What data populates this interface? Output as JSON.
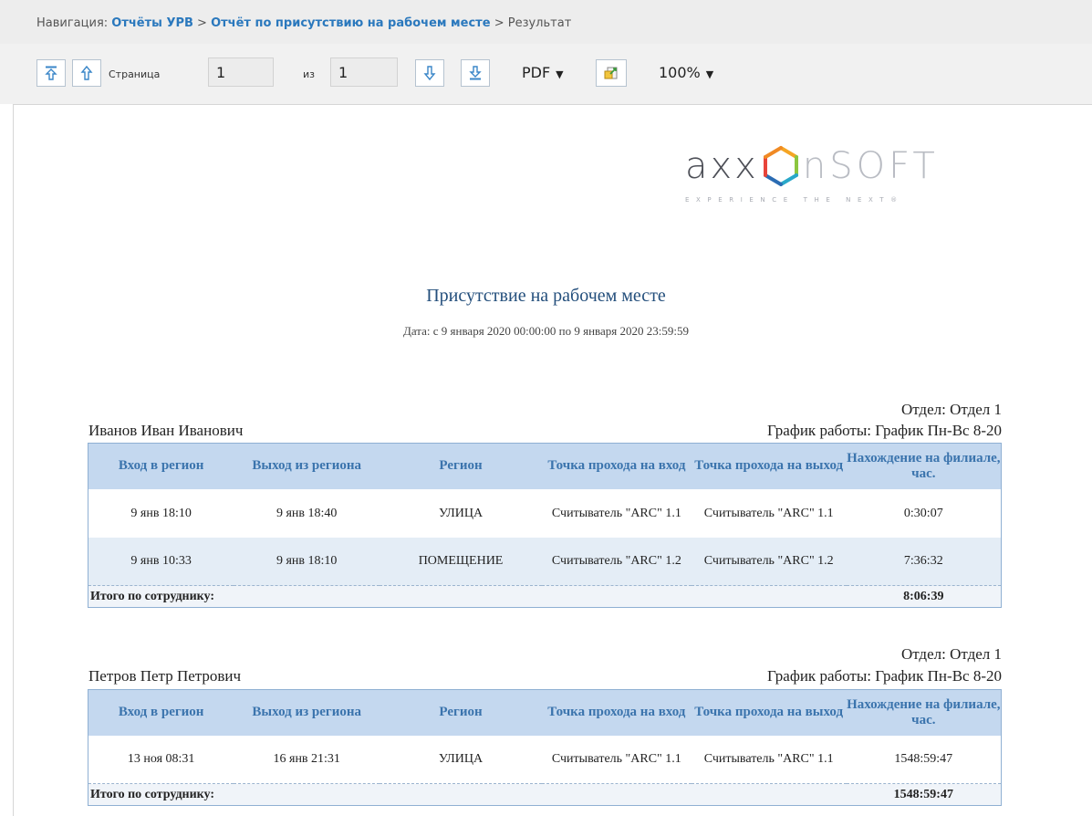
{
  "navigation": {
    "prefix": "Навигация:",
    "crumbs": [
      "Отчёты УРВ",
      "Отчёт по присутствию на рабочем месте"
    ],
    "separator": ">",
    "current": "Результат"
  },
  "toolbar": {
    "page_label": "Страница",
    "page_value": "1",
    "of_label": "из",
    "total_pages": "1",
    "format": "PDF",
    "zoom": "100%",
    "buttons": [
      "first-page-icon",
      "prev-page-icon",
      "next-page-icon",
      "last-page-icon",
      "export-icon"
    ]
  },
  "logo": {
    "brand_left": "axx",
    "brand_right": "nSOFT",
    "tagline": "EXPERIENCE THE NEXT®"
  },
  "report": {
    "title": "Присутствие на рабочем месте",
    "date_range": "Дата: с 9 января 2020 00:00:00 по 9 января 2020 23:59:59",
    "columns": [
      "Вход в регион",
      "Выход из региона",
      "Регион",
      "Точка прохода на вход",
      "Точка прохода на выход",
      "Нахождение на филиале, час."
    ],
    "total_label": "Итого по сотруднику:",
    "employees": [
      {
        "department": "Отдел: Отдел 1",
        "name": "Иванов Иван Иванович",
        "schedule": "График работы: График Пн-Вс 8-20",
        "rows": [
          [
            "9 янв 18:10",
            "9 янв 18:40",
            "УЛИЦА",
            "Считыватель \"ARC\" 1.1",
            "Считыватель \"ARC\" 1.1",
            "0:30:07"
          ],
          [
            "9 янв 10:33",
            "9 янв 18:10",
            "ПОМЕЩЕНИЕ",
            "Считыватель \"ARC\" 1.2",
            "Считыватель \"ARC\" 1.2",
            "7:36:32"
          ]
        ],
        "total": "8:06:39"
      },
      {
        "department": "Отдел: Отдел 1",
        "name": "Петров Петр Петрович",
        "schedule": "График работы: График Пн-Вс 8-20",
        "rows": [
          [
            "13 ноя 08:31",
            "16 янв 21:31",
            "УЛИЦА",
            "Считыватель \"ARC\" 1.1",
            "Считыватель \"ARC\" 1.1",
            "1548:59:47"
          ]
        ],
        "total": "1548:59:47"
      }
    ]
  },
  "colors": {
    "link": "#2a78bd",
    "header_bg": "#c4d8ef",
    "header_text": "#3b74ad",
    "alt_row": "#e4edf6",
    "logo_orange": "#f5a524",
    "logo_teal": "#29a8c9"
  }
}
